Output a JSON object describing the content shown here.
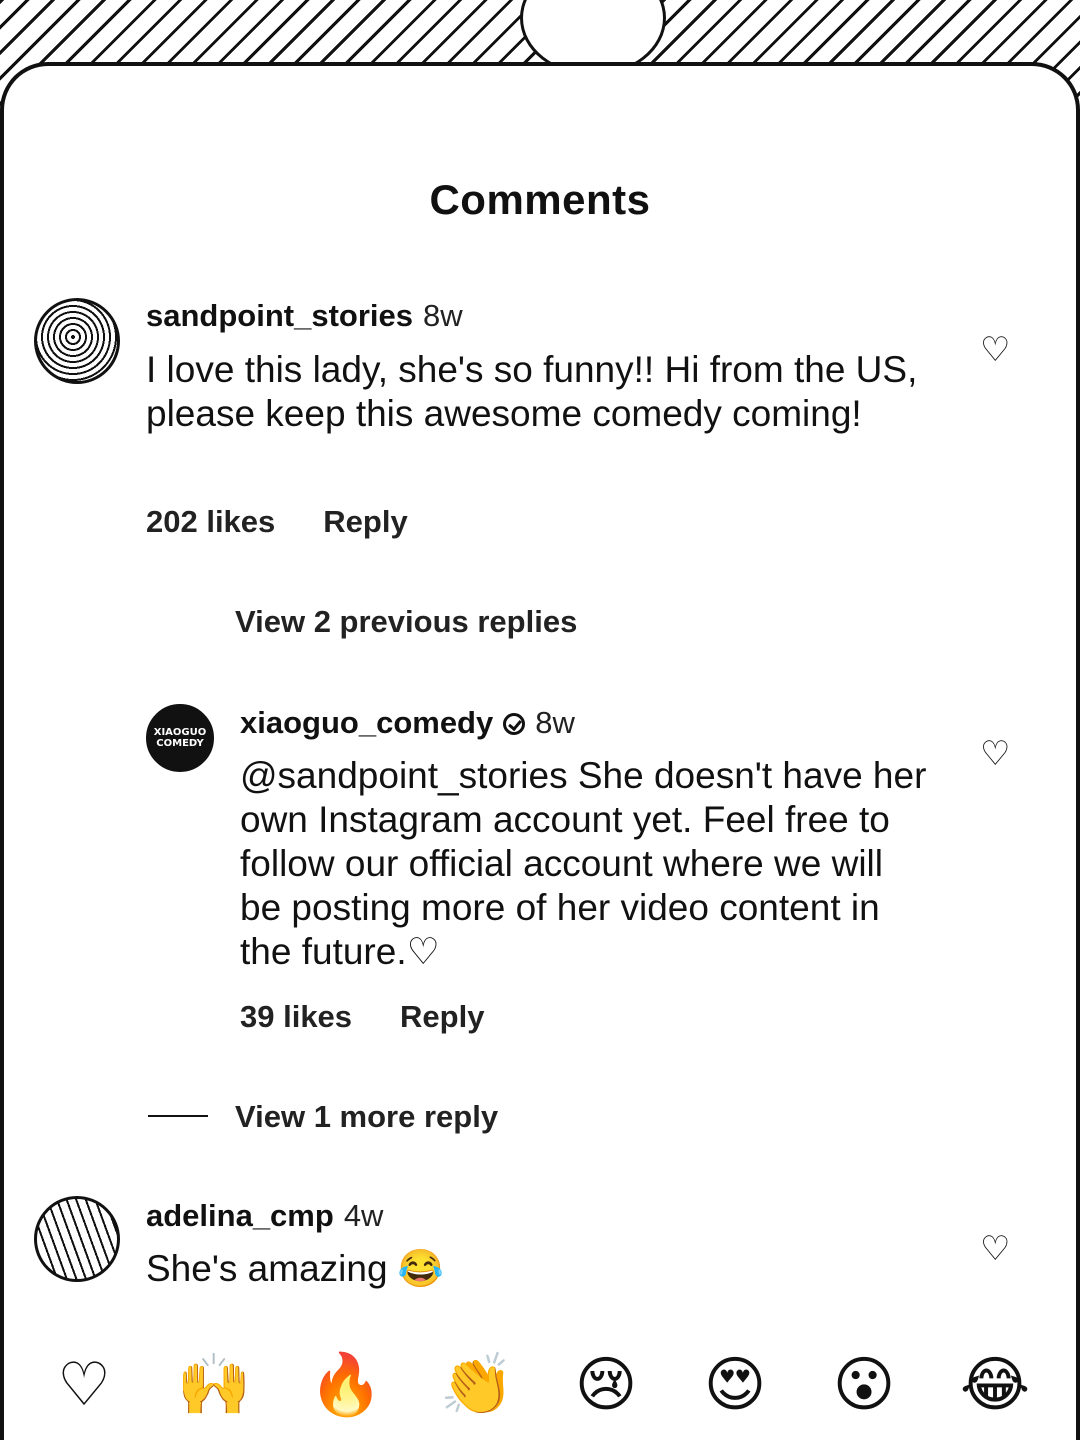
{
  "header": {
    "title": "Comments"
  },
  "comments": [
    {
      "username": "sandpoint_stories",
      "time": "8w",
      "text": "I love this lady, she's so funny!! Hi from the US, please keep this awesome comedy coming!",
      "likes": "202 likes",
      "reply_label": "Reply",
      "view_replies": "View 2 previous replies"
    },
    {
      "username": "xiaoguo_comedy",
      "verified": true,
      "time": "8w",
      "avatar_text": "XIAOGUO COMEDY",
      "text": "@sandpoint_stories She doesn't have her own Instagram account yet. Feel free to follow our official account where we will be posting more of her video content in the future.♡",
      "likes": "39 likes",
      "reply_label": "Reply",
      "view_replies": "View 1 more reply"
    },
    {
      "username": "adelina_cmp",
      "time": "4w",
      "text": "She's amazing 😂"
    }
  ],
  "icons": {
    "like": "heart-outline-icon"
  },
  "emoji_bar": [
    "♡",
    "🙌",
    "🔥",
    "👏",
    "😢",
    "😍",
    "😮",
    "😂"
  ]
}
